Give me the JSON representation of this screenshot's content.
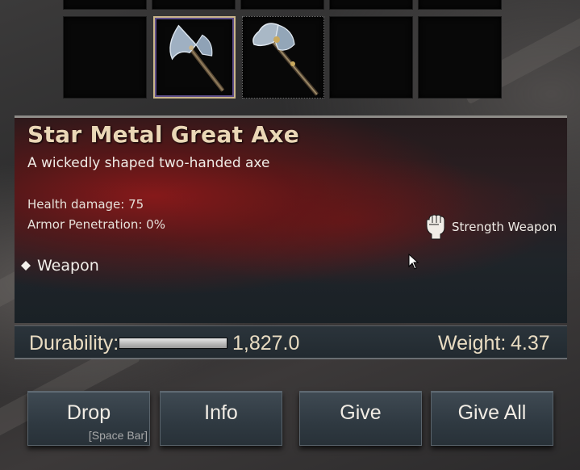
{
  "item": {
    "name": "Star Metal Great Axe",
    "description": "A wickedly shaped two-handed axe",
    "stats": [
      {
        "label": "Health damage: 75"
      },
      {
        "label": "Armor Penetration: 0%"
      }
    ],
    "perk": {
      "icon": "fist-icon",
      "label": "Strength Weapon"
    },
    "tag": {
      "icon": "diamond-bullet-icon",
      "label": "Weapon"
    }
  },
  "infobar": {
    "durability_label": "Durability:",
    "durability_value": "1,827.0",
    "durability_fraction": 1.0,
    "weight_label": "Weight:",
    "weight_value": "4.37"
  },
  "buttons": {
    "drop": {
      "label": "Drop",
      "hint": "[Space Bar]"
    },
    "info": {
      "label": "Info"
    },
    "give": {
      "label": "Give"
    },
    "give_all": {
      "label": "Give All"
    }
  },
  "inventory": {
    "slots": [
      {
        "item": "",
        "icon": ""
      },
      {
        "item": "Star Metal Great Axe",
        "icon": "great-axe-icon",
        "selected": true
      },
      {
        "item": "",
        "icon": "double-axe-icon"
      },
      {
        "item": "",
        "icon": ""
      },
      {
        "item": "",
        "icon": ""
      }
    ]
  },
  "colors": {
    "title": "#ead7b6",
    "panel_red": "#961818",
    "button_bg": "#2f3941",
    "selected_border": "#c9b48a"
  }
}
